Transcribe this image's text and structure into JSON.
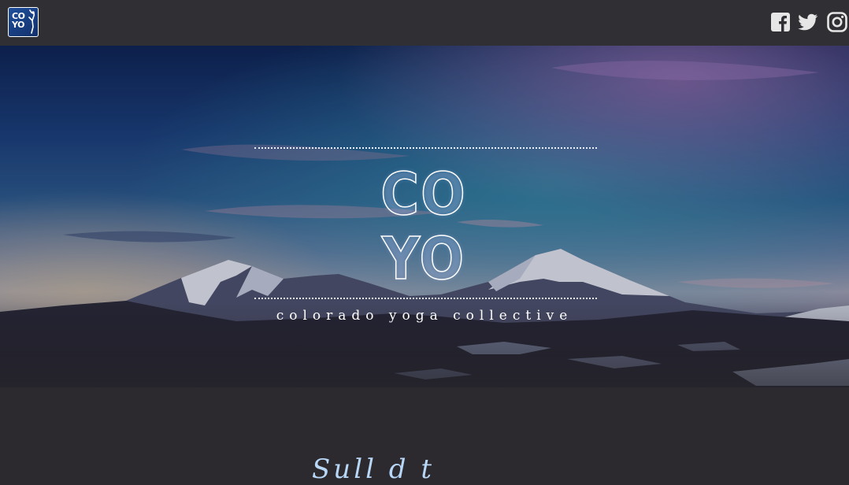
{
  "header": {
    "logo_text_line1": "CO",
    "logo_text_line2": "YO",
    "social_icons": [
      "facebook-icon",
      "twitter-icon",
      "instagram-icon"
    ]
  },
  "hero": {
    "title_line1": "CO",
    "title_line2": "YO",
    "tagline": "colorado yoga collective"
  },
  "section": {
    "script_heading": "Sull  d  t"
  },
  "colors": {
    "nav_bg": "#303034",
    "page_bg": "#2c2a2f",
    "logo_blue": "#1f4f9c",
    "script_text": "#b8d6f6"
  }
}
